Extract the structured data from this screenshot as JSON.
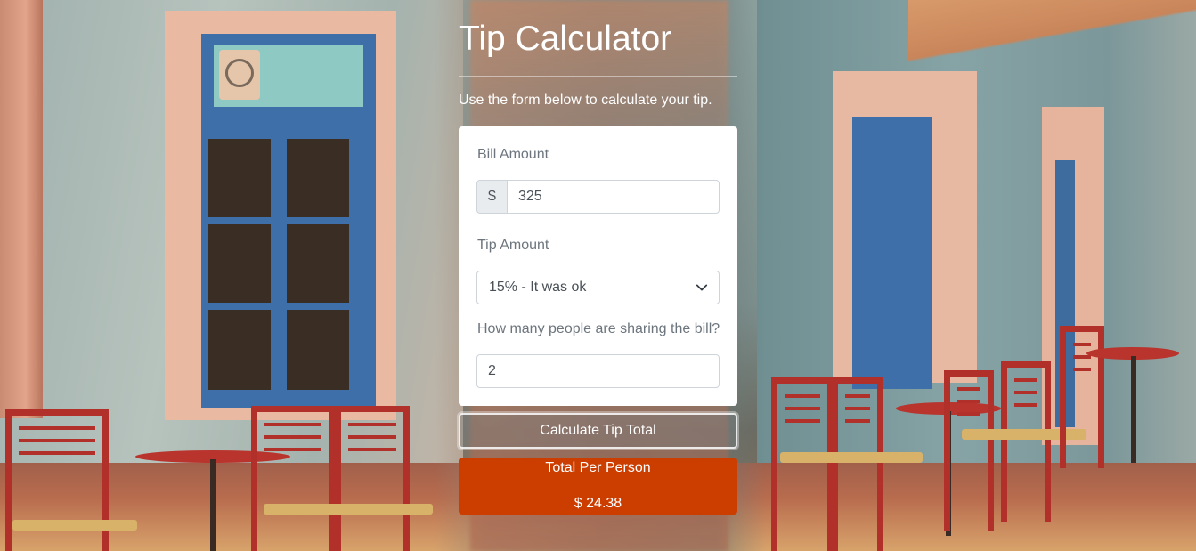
{
  "page": {
    "title": "Tip Calculator",
    "intro": "Use the form below to calculate your tip."
  },
  "form": {
    "bill_label": "Bill Amount",
    "currency_symbol": "$",
    "bill_value": "325",
    "tip_label": "Tip Amount",
    "tip_selected": "15% - It was ok",
    "people_label": "How many people are sharing the bill?",
    "people_value": "2"
  },
  "actions": {
    "calculate_label": "Calculate Tip Total"
  },
  "result": {
    "label": "Total Per Person",
    "value": "$ 24.38"
  },
  "colors": {
    "result_bg": "#cc3d00",
    "label_gray": "#6c757d"
  },
  "icons": {
    "select_chevron": "chevron-down-icon"
  }
}
